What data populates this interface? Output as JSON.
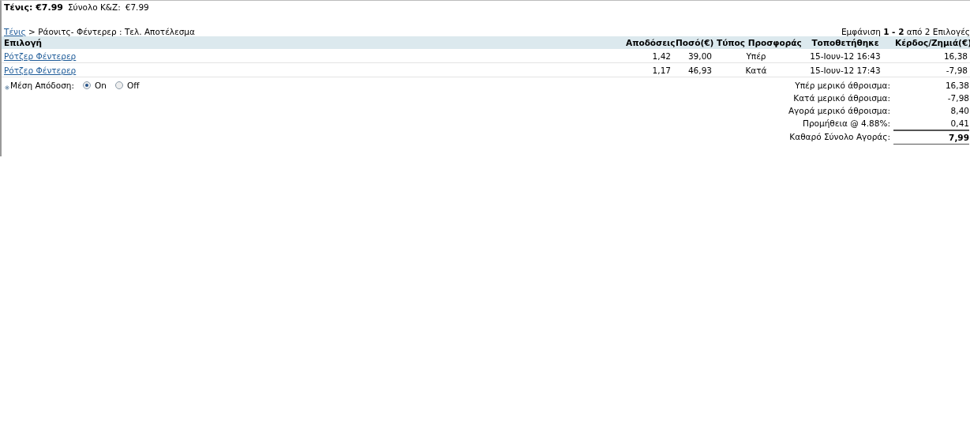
{
  "header": {
    "title": "Τένις: €7.99",
    "total_label": "Σύνολο Κ&Ζ:",
    "total_value": "€7.99"
  },
  "breadcrumb": {
    "link": "Τένις",
    "separator": ">",
    "current": "Ράονιτς- Φέντερερ : Τελ. Αποτέλεσμα"
  },
  "paging": {
    "prefix": "Εμφάνιση",
    "range": "1 - 2",
    "suffix": "από 2 Επιλογές"
  },
  "table": {
    "columns": [
      "Επιλογή",
      "Αποδόσεις",
      "Ποσό(€)",
      "Τύπος Προσφοράς",
      "Τοποθετήθηκε",
      "Κέρδος/Ζημιά(€)"
    ],
    "rows": [
      {
        "selection": "Ρότζερ Φέντερερ",
        "odds": "1,42",
        "stake": "39,00",
        "type": "Υπέρ",
        "placed": "15-Ιουν-12 16:43",
        "profit": "16,38"
      },
      {
        "selection": "Ρότζερ Φέντερερ",
        "odds": "1,17",
        "stake": "46,93",
        "type": "Κατά",
        "placed": "15-Ιουν-12 17:43",
        "profit": "-7,98"
      }
    ]
  },
  "average_odds": {
    "label": "Μέση Απόδοση:",
    "options": [
      {
        "label": "On",
        "selected": true
      },
      {
        "label": "Off",
        "selected": false
      }
    ]
  },
  "summary": [
    {
      "label": "Υπέρ μερικό άθροισμα:",
      "value": "16,38",
      "kind": "plain"
    },
    {
      "label": "Κατά μερικό άθροισμα:",
      "value": "-7,98",
      "kind": "plain"
    },
    {
      "label": "Αγορά μερικό άθροισμα:",
      "value": "8,40",
      "kind": "plain"
    },
    {
      "label": "Προμήθεια @ 4.88%:",
      "value": "0,41",
      "kind": "plain"
    },
    {
      "label": "Καθαρό Σύνολο Αγοράς:",
      "value": "7,99",
      "kind": "total"
    }
  ]
}
